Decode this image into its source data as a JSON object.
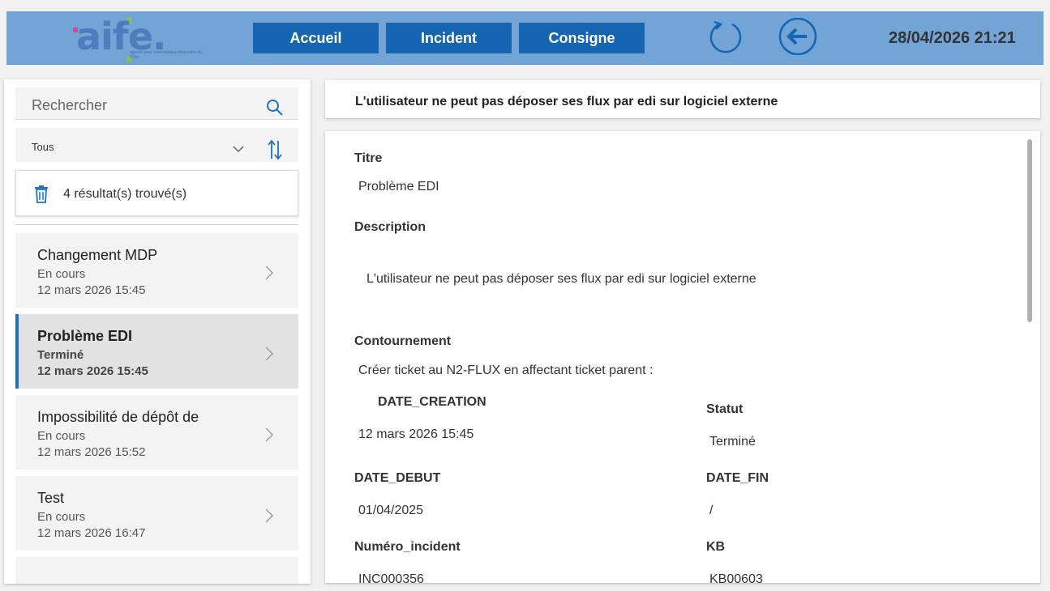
{
  "header": {
    "logo_text": "aife.",
    "logo_subtitle": "agence pour l'informatique financière de l'État",
    "nav": [
      "Accueil",
      "Incident",
      "Consigne"
    ],
    "datetime": "28/04/2026 21:21"
  },
  "left": {
    "search": {
      "placeholder": "Rechercher"
    },
    "filter": {
      "value": "Tous"
    },
    "result_count": "4 résultat(s) trouvé(s)",
    "items": [
      {
        "title": "Changement MDP",
        "status": "En cours",
        "date": "12 mars 2026 15:45"
      },
      {
        "title": "Problème EDI",
        "status": "Terminé",
        "date": "12 mars 2026 15:45"
      },
      {
        "title": "Impossibilité de dépôt de",
        "status": "En cours",
        "date": "12 mars 2026 15:52"
      },
      {
        "title": "Test",
        "status": "En cours",
        "date": "12 mars 2026 16:47"
      }
    ]
  },
  "detail": {
    "header_title": "L'utilisateur ne peut pas déposer ses flux par edi sur logiciel externe",
    "titre_label": "Titre",
    "titre_value": "Problème EDI",
    "description_label": "Description",
    "description_value": "L'utilisateur ne peut pas déposer ses flux par edi sur logiciel externe",
    "contournement_label": "Contournement",
    "contournement_value": "Créer ticket au N2-FLUX en affectant ticket parent :",
    "date_creation_label": "DATE_CREATION",
    "date_creation_value": "12 mars 2026 15:45",
    "statut_label": "Statut",
    "statut_value": "Terminé",
    "date_debut_label": "DATE_DEBUT",
    "date_debut_value": "01/04/2025",
    "date_fin_label": "DATE_FIN",
    "date_fin_value": "/",
    "numero_incident_label": "Numéro_incident",
    "numero_incident_value": "INC000356",
    "kb_label": "KB",
    "kb_value": "KB00603"
  },
  "colors": {
    "header_bg": "#73a4d6",
    "nav_button": "#1565b2",
    "accent": "#1a73c4"
  }
}
